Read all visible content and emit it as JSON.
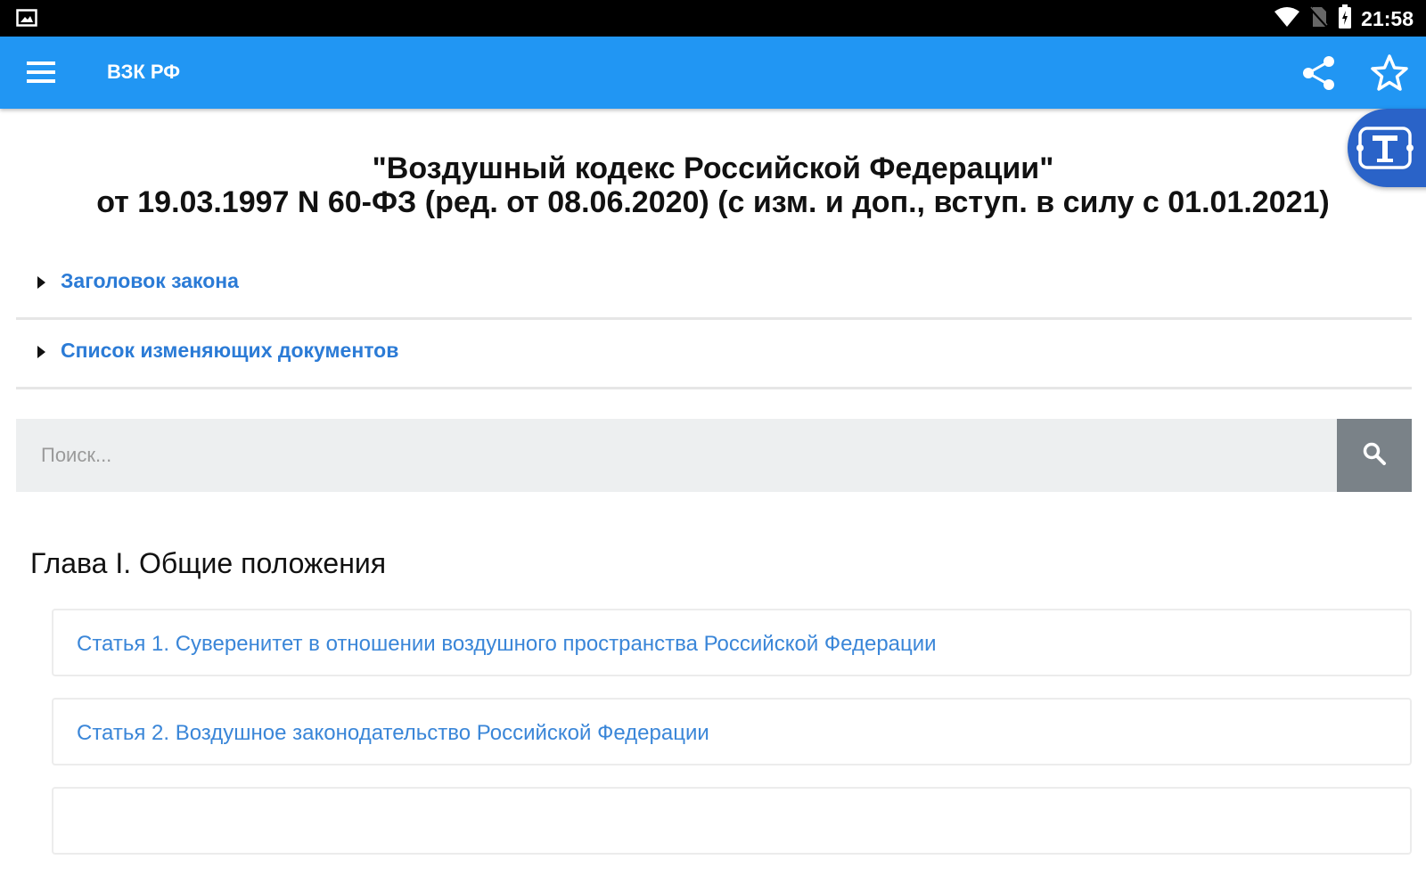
{
  "status_bar": {
    "time": "21:58",
    "icons": [
      "image-icon",
      "wifi-icon",
      "no-sim-icon",
      "battery-icon"
    ]
  },
  "app_bar": {
    "title": "ВЗК РФ",
    "icons": [
      "menu-icon",
      "share-icon",
      "star-icon"
    ],
    "background_color": "#2196f3"
  },
  "fab": {
    "icon": "text-t-icon",
    "color": "#2a63c8"
  },
  "document": {
    "title_line1": "\"Воздушный кодекс Российской Федерации\"",
    "title_line2": "от 19.03.1997 N 60-ФЗ (ред. от 08.06.2020) (с изм. и доп., вступ. в силу с 01.01.2021)"
  },
  "accordion": [
    {
      "label": "Заголовок закона"
    },
    {
      "label": "Список изменяющих документов"
    }
  ],
  "search": {
    "placeholder": "Поиск...",
    "value": "",
    "icon": "search-icon"
  },
  "chapter": {
    "title": "Глава I. Общие положения"
  },
  "articles": [
    {
      "label": "Статья 1. Суверенитет в отношении воздушного пространства Российской Федерации"
    },
    {
      "label": "Статья 2. Воздушное законодательство Российской Федерации"
    },
    {
      "label": ""
    }
  ],
  "colors": {
    "link": "#3a86d8",
    "accordion_link": "#2b7bd6",
    "search_button": "#7a8288",
    "search_bg": "#edeff0"
  }
}
